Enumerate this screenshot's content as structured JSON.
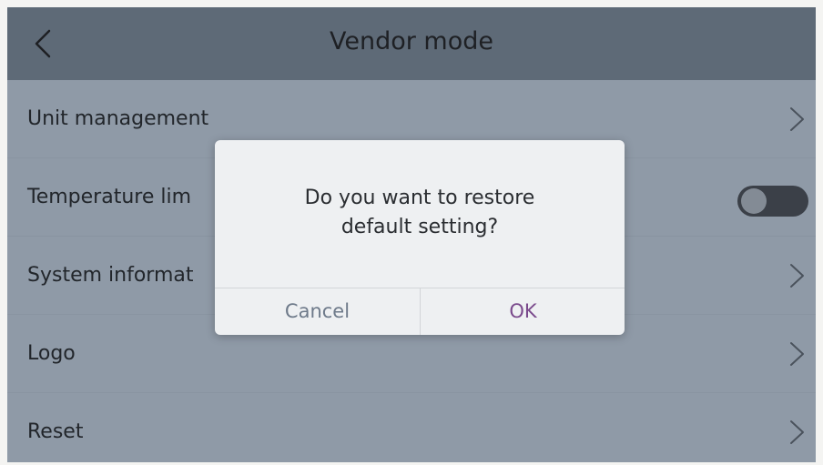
{
  "header": {
    "title": "Vendor mode",
    "back_icon": "chevron-left-icon"
  },
  "menu": {
    "items": [
      {
        "label": "Unit management",
        "control": "chevron-right-icon"
      },
      {
        "label": "Temperature lim",
        "control": "toggle",
        "toggle_on": false
      },
      {
        "label": "System informat",
        "control": "chevron-right-icon"
      },
      {
        "label": "Logo",
        "control": "chevron-right-icon"
      },
      {
        "label": "Reset",
        "control": "chevron-right-icon"
      }
    ]
  },
  "dialog": {
    "message_line1": "Do you want to restore",
    "message_line2": "default setting?",
    "cancel_label": "Cancel",
    "ok_label": "OK",
    "ok_color": "#7a4a8c",
    "cancel_color": "#6e7a8a"
  },
  "colors": {
    "overlay_background": "#8f9aa7",
    "header_background": "#5e6a77",
    "dialog_background": "#eef0f2"
  }
}
